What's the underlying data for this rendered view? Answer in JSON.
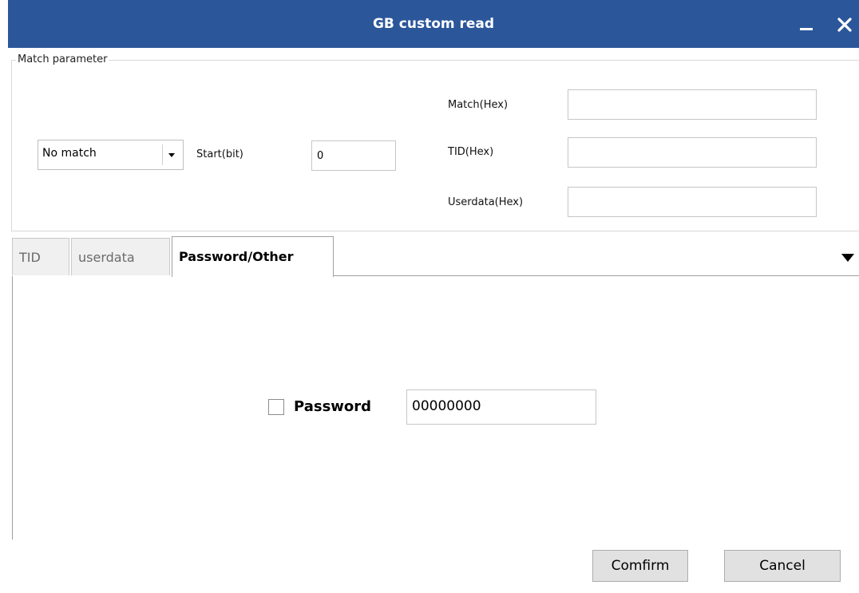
{
  "window": {
    "title": "GB custom read",
    "minimize_glyph": "minimize-icon",
    "close_glyph": "close-icon",
    "title_bg": "#2b579a"
  },
  "match_group": {
    "legend": "Match parameter",
    "match_mode": {
      "value": "No match"
    },
    "start_label": "Start(bit)",
    "start_value": "0",
    "match_hex_label": "Match(Hex)",
    "match_hex_value": "",
    "tid_hex_label": "TID(Hex)",
    "tid_hex_value": "",
    "userdata_hex_label": "Userdata(Hex)",
    "userdata_hex_value": ""
  },
  "tabs": [
    {
      "label": "TID",
      "active": false
    },
    {
      "label": "userdata",
      "active": false
    },
    {
      "label": "Password/Other",
      "active": true
    }
  ],
  "password_tab": {
    "password_label": "Password",
    "password_checked": false,
    "password_value": "00000000"
  },
  "footer": {
    "confirm_label": "Comfirm",
    "cancel_label": "Cancel"
  }
}
